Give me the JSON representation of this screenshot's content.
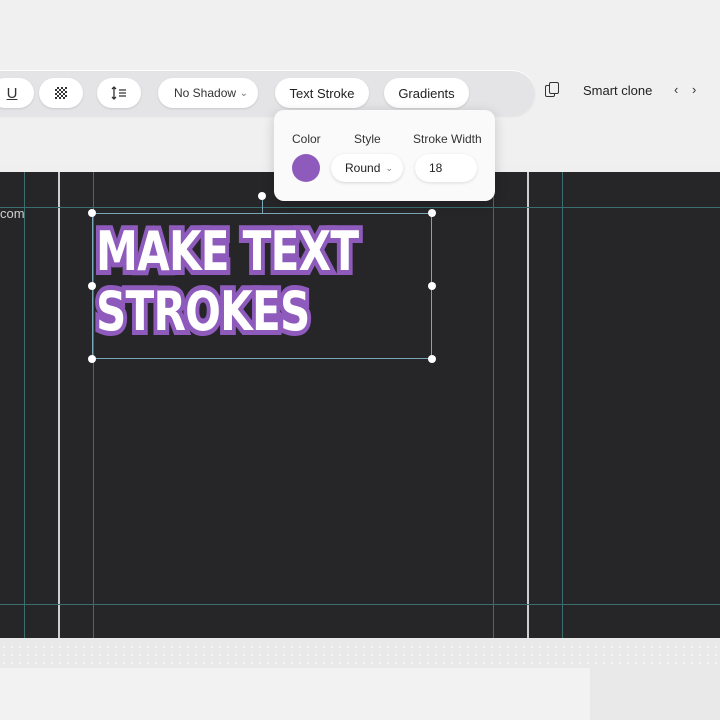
{
  "toolbar": {
    "underline_glyph": "U",
    "shadow_select": "No Shadow",
    "text_stroke_label": "Text Stroke",
    "gradients_label": "Gradients"
  },
  "right_tools": {
    "smart_clone_label": "Smart clone",
    "prev_glyph": "‹",
    "next_glyph": "›"
  },
  "canvas": {
    "url_fragment": "com",
    "text_lines": [
      "MAKE TEXT",
      "STROKES"
    ]
  },
  "stroke_popover": {
    "color_label": "Color",
    "style_label": "Style",
    "width_label": "Stroke Width",
    "color_value": "#8e5bbd",
    "style_value": "Round",
    "width_value": "18"
  },
  "icons": {
    "transparency": "checkerboard-icon",
    "spacing": "line-spacing-icon",
    "copy": "copy-icon"
  },
  "colors": {
    "canvas_bg": "#262628",
    "stroke": "#8e5bbd",
    "guides": "#3a6f72"
  }
}
